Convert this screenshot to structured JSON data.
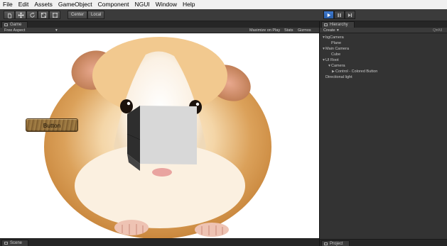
{
  "menu": {
    "items": [
      "File",
      "Edit",
      "Assets",
      "GameObject",
      "Component",
      "NGUI",
      "Window",
      "Help"
    ]
  },
  "toolbar": {
    "tools": [
      "hand-icon",
      "move-icon",
      "rotate-icon",
      "scale-icon",
      "rect-icon"
    ],
    "pivot_label": "Center",
    "space_label": "Local",
    "play_controls": [
      "play-icon",
      "pause-icon",
      "step-icon"
    ],
    "play_active": true
  },
  "game_panel": {
    "tab_label": "Game",
    "aspect_label": "Free Aspect",
    "maximize_label": "Maximize on Play",
    "stats_label": "Stats",
    "gizmos_label": "Gizmos",
    "button_label": "Button"
  },
  "scene_panel": {
    "tab_label": "Scene"
  },
  "hierarchy": {
    "tab_label": "Hierarchy",
    "create_label": "Create",
    "search_label": "Q▾All",
    "items": [
      {
        "label": "bgCamera",
        "depth": 0,
        "expanded": true
      },
      {
        "label": "Plane",
        "depth": 1
      },
      {
        "label": "Main Camera",
        "depth": 0,
        "expanded": true
      },
      {
        "label": "Cube",
        "depth": 1
      },
      {
        "label": "UI Root",
        "depth": 0,
        "expanded": true
      },
      {
        "label": "Camera",
        "depth": 1,
        "expanded": true
      },
      {
        "label": "Control - Colored Button",
        "depth": 2
      },
      {
        "label": "Directional light",
        "depth": 0
      }
    ]
  },
  "project_panel": {
    "tab_label": "Project"
  },
  "colors": {
    "accent": "#3f7ad0",
    "panel": "#333333",
    "menubar": "#f0f0f0"
  }
}
